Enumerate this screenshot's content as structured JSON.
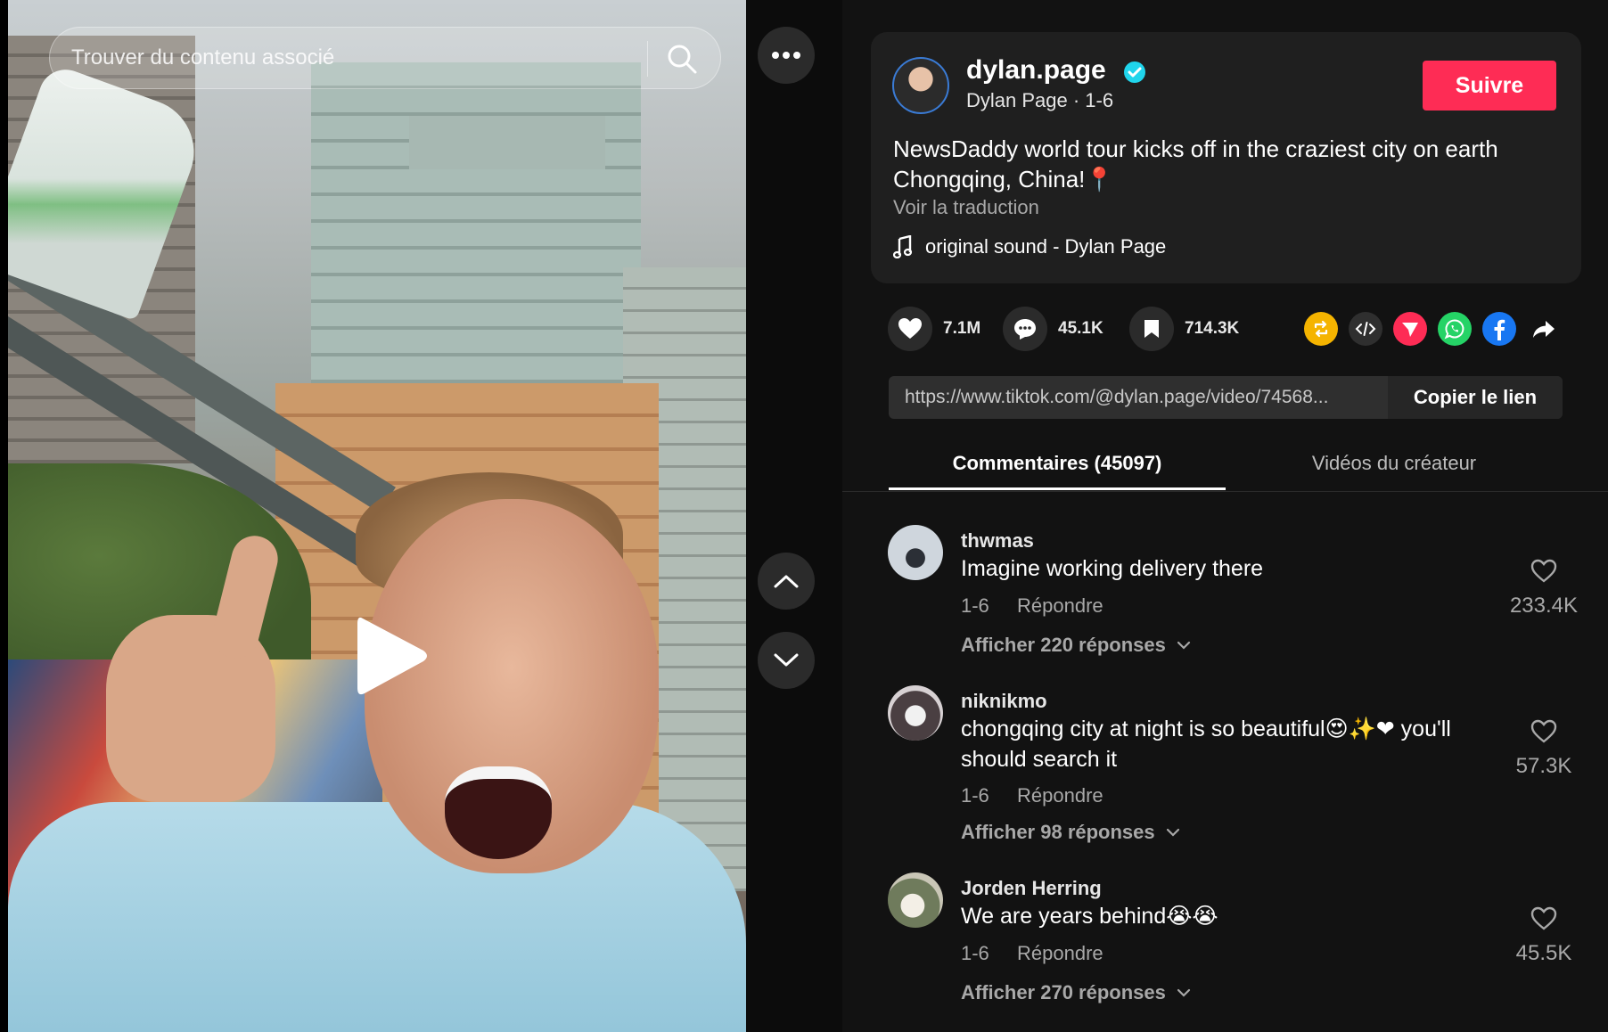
{
  "search": {
    "placeholder": "Trouver du contenu associé"
  },
  "author": {
    "username": "dylan.page",
    "display_name": "Dylan Page",
    "date": "1-6",
    "subline": "Dylan Page · 1-6",
    "follow_label": "Suivre"
  },
  "post": {
    "caption_line1": "NewsDaddy world tour kicks off in the craziest city on earth",
    "caption_line2": "Chongqing, China!📍",
    "translate_label": "Voir la traduction",
    "sound": "original sound - Dylan Page"
  },
  "stats": {
    "likes": "7.1M",
    "comments": "45.1K",
    "saves": "714.3K"
  },
  "share_icons": [
    "repost-icon",
    "embed-icon",
    "send-icon",
    "whatsapp-icon",
    "facebook-icon",
    "share-icon"
  ],
  "link": {
    "url": "https://www.tiktok.com/@dylan.page/video/74568...",
    "copy_label": "Copier le lien"
  },
  "tabs": {
    "comments": "Commentaires (45097)",
    "creator": "Vidéos du créateur"
  },
  "comments": [
    {
      "user": "thwmas",
      "text": "Imagine working delivery there",
      "date": "1-6",
      "reply_label": "Répondre",
      "view_replies": "Afficher 220 réponses",
      "likes": "233.4K"
    },
    {
      "user": "niknikmo",
      "text_line1": "chongqing city at night is so beautiful😍✨❤ you'll",
      "text_line2": "should search it",
      "date": "1-6",
      "reply_label": "Répondre",
      "view_replies": "Afficher 98 réponses",
      "likes": "57.3K"
    },
    {
      "user": "Jorden Herring",
      "text": "We are years behind😭😭",
      "date": "1-6",
      "reply_label": "Répondre",
      "view_replies": "Afficher 270 réponses",
      "likes": "45.5K"
    }
  ],
  "colors": {
    "accent": "#fe2c55",
    "verified": "#20d5ec",
    "panel_bg": "#121212",
    "card_bg": "#1f1f1f"
  }
}
